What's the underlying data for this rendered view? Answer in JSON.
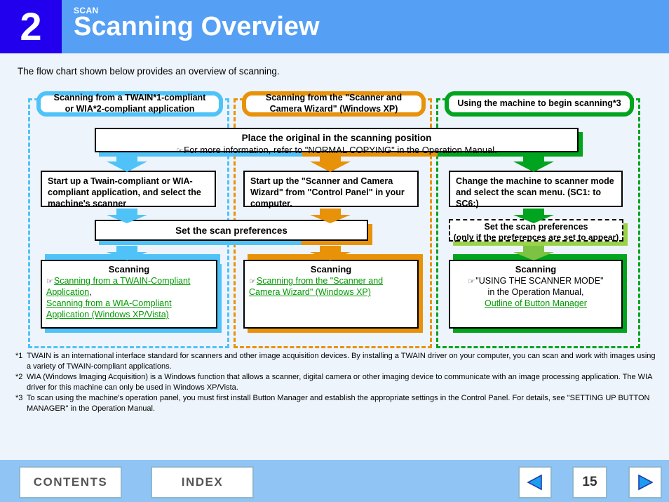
{
  "header": {
    "chapter_number": "2",
    "kicker": "SCAN",
    "title": "Scanning Overview",
    "badge_color": "#2200EE",
    "bar_color": "#55A0F5"
  },
  "intro": "The flow chart shown below provides an overview of scanning.",
  "flow": {
    "columns": [
      {
        "id": "twain",
        "color": "#4FC3F7",
        "heading": "Scanning from a TWAIN*1-compliant or WIA*2-compliant application",
        "heading_line1": "Scanning from a TWAIN*1-compliant",
        "heading_line2": "or WIA*2-compliant application",
        "step": "Start up a Twain-compliant or WIA-compliant application, and select the machine's scanner",
        "result_title": "Scanning",
        "links": [
          "Scanning from a TWAIN-Compliant Application",
          "Scanning from a WIA-Compliant Application (Windows XP/Vista)"
        ]
      },
      {
        "id": "wizard",
        "color": "#E8920A",
        "heading": "Scanning from the \"Scanner and Camera Wizard\" (Windows XP)",
        "heading_line1": "Scanning from the \"Scanner and",
        "heading_line2": "Camera Wizard\" (Windows XP)",
        "step": "Start up the \"Scanner and Camera Wizard\" from \"Control Panel\" in your computer.",
        "result_title": "Scanning",
        "links": [
          "Scanning from the \"Scanner and Camera Wizard\" (Windows XP)"
        ]
      },
      {
        "id": "machine",
        "color": "#00A41E",
        "heading": "Using the machine to begin scanning*3",
        "heading_line1": "Using the machine to begin scanning*3",
        "heading_line2": "",
        "step": "Change the machine to scanner mode and select the scan menu. (SC1: to SC6:)",
        "result_title": "Scanning",
        "plain_lines": [
          "\"USING THE SCANNER MODE\"",
          "in the Operation Manual,"
        ],
        "links": [
          "Outline of Button Manager"
        ]
      }
    ],
    "shared_step": {
      "title": "Place the original in the scanning position",
      "detail": "For more information, refer to \"NORMAL COPYING\" in the Operation Manual."
    },
    "preferences_shared": "Set the scan preferences",
    "preferences_machine_line1": "Set the scan preferences",
    "preferences_machine_line2": "(only if the preferences are set to appear)"
  },
  "footnotes": [
    {
      "marker": "*1",
      "text": "TWAIN is an international interface standard for scanners and other image acquisition devices. By installing a TWAIN driver on your computer, you can scan and work with images using a variety of TWAIN-compliant applications."
    },
    {
      "marker": "*2",
      "text": "WIA (Windows Imaging Acquisition) is a Windows function that allows a scanner, digital camera or other imaging device to communicate with an image processing application. The WIA driver for this machine can only be used in Windows XP/Vista."
    },
    {
      "marker": "*3",
      "text": "To scan using the machine's operation panel, you must first install Button Manager and establish the appropriate settings in the Control Panel. For details, see \"SETTING UP BUTTON MANAGER\" in the Operation Manual."
    }
  ],
  "nav": {
    "contents_label": "CONTENTS",
    "index_label": "INDEX",
    "page_number": "15",
    "prev_icon": "previous-page-arrow",
    "next_icon": "next-page-arrow"
  }
}
